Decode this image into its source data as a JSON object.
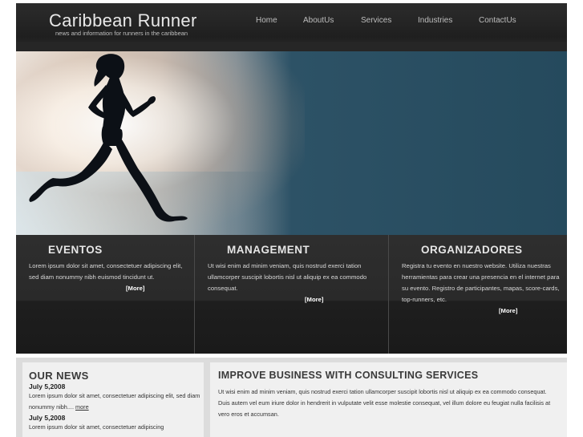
{
  "header": {
    "title": "Caribbean Runner",
    "tagline": "news and information for runners in the caribbean",
    "nav": [
      "Home",
      "AboutUs",
      "Services",
      "Industries",
      "ContactUs"
    ]
  },
  "features": [
    {
      "heading": "EVENTOS",
      "text": "Lorem ipsum dolor sit amet, consectetuer adipiscing elit, sed diam nonummy nibh euismod tincidunt ut.",
      "more": "[More]"
    },
    {
      "heading": "MANAGEMENT",
      "text": "Ut wisi enim ad minim veniam, quis nostrud exerci tation ullamcorper suscipit lobortis nisl ut aliquip ex ea commodo consequat.",
      "more": "[More]"
    },
    {
      "heading": "ORGANIZADORES",
      "text": "Registra tu evento en nuestro website. Utiliza nuestras herramientas para crear una presencia en el internet para su evento. Registro de participantes, mapas, score-cards, top-runners, etc.",
      "more": "[More]"
    }
  ],
  "news": {
    "heading": "OUR NEWS",
    "items": [
      {
        "date": "July 5,2008",
        "text": "Lorem ipsum dolor sit amet, consectetuer adipiscing elit, sed diam nonummy nibh....",
        "link": "more"
      },
      {
        "date": "July 5,2008",
        "text": "Lorem ipsum dolor sit amet, consectetuer adipiscing"
      }
    ]
  },
  "consulting": {
    "heading": "IMPROVE BUSINESS WITH CONSULTING SERVICES",
    "text": "Ut wisi enim ad minim veniam, quis nostrud exerci tation ullamcorper suscipit lobortis nisl ut aliquip ex ea commodo consequat. Duis autem vel eum iriure dolor in hendrerit in vulputate velit esse molestie consequat, vel illum dolore eu feugiat nulla facilisis at vero eros et accumsan."
  },
  "colors": {
    "header_bg": "#262626",
    "hero_blue": "#254a5d",
    "feature_bg": "#2a2a2a",
    "bottom_bg": "#dcdcdc"
  }
}
